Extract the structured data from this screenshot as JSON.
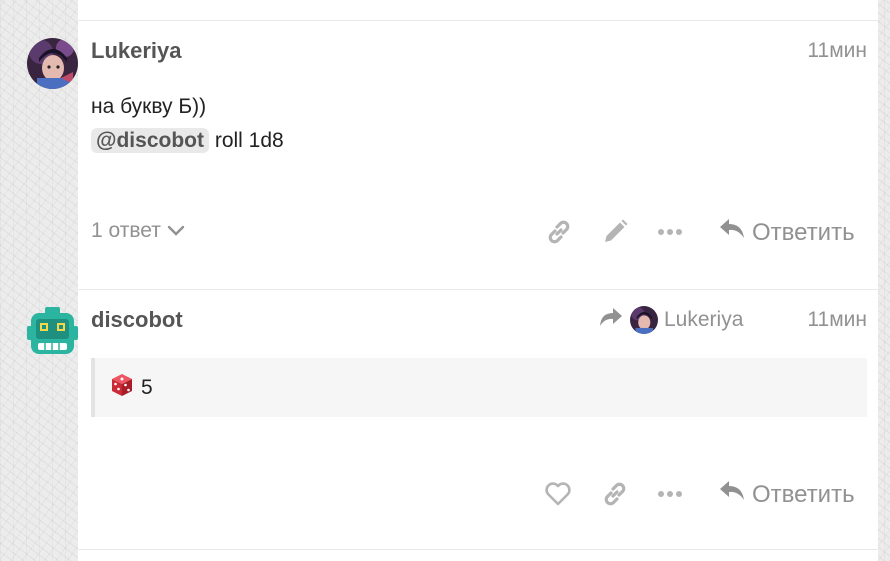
{
  "post1": {
    "username": "Lukeriya",
    "time": "11мин",
    "line1": "на букву Б))",
    "mention": "@discobot",
    "command": "roll 1d8",
    "replies_label": "1 ответ",
    "reply_label": "Ответить"
  },
  "post2": {
    "username": "discobot",
    "reply_to_user": "Lukeriya",
    "time": "11мин",
    "dice_result": "5",
    "reply_label": "Ответить"
  },
  "icons": {
    "link": "link-icon",
    "edit": "pencil-icon",
    "more": "ellipsis-icon",
    "reply": "reply-arrow-icon",
    "like": "heart-icon",
    "share_arrow": "share-arrow-icon",
    "dice": "dice-icon",
    "chevron": "chevron-down-icon"
  },
  "colors": {
    "muted": "#919191",
    "username": "#555555",
    "bot_green": "#2bb4a0",
    "dice_red": "#d8313c"
  }
}
